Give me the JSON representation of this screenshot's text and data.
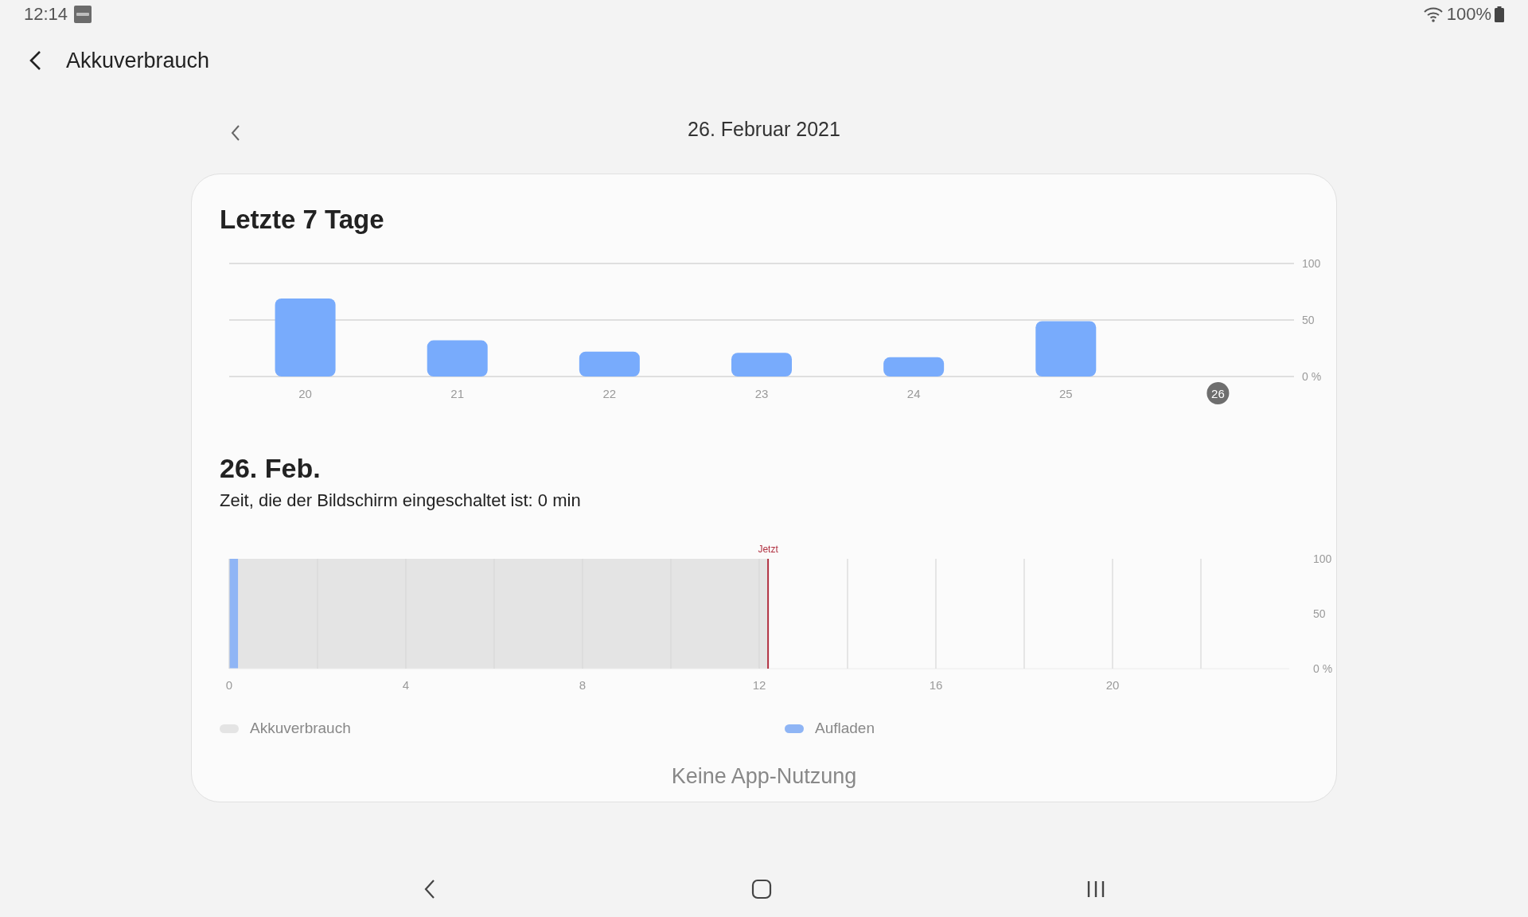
{
  "status_bar": {
    "time": "12:14",
    "battery": "100%"
  },
  "header": {
    "title": "Akkuverbrauch"
  },
  "date_nav": {
    "date": "26. Februar 2021"
  },
  "week": {
    "title": "Letzte 7 Tage",
    "days": [
      {
        "selected": false
      },
      {
        "selected": false
      },
      {
        "selected": false
      },
      {
        "selected": false
      },
      {
        "selected": false
      },
      {
        "selected": false
      },
      {
        "selected": true
      }
    ],
    "chart_data": {
      "type": "bar",
      "categories": [
        "20",
        "21",
        "22",
        "23",
        "24",
        "25",
        "26"
      ],
      "values": [
        69,
        32,
        22,
        21,
        17,
        49,
        null
      ],
      "ylim": [
        0,
        100
      ],
      "yticks": [
        {
          "value": 0,
          "label": "0 %"
        },
        {
          "value": 50,
          "label": "50"
        },
        {
          "value": 100,
          "label": "100"
        }
      ]
    }
  },
  "day": {
    "title": "26. Feb.",
    "screen_time": "Zeit, die der Bildschirm eingeschaltet ist: 0 min",
    "chart_data": {
      "type": "area",
      "x": [
        0,
        0.2,
        12.2
      ],
      "xlim": [
        0,
        24
      ],
      "ylim": [
        0,
        100
      ],
      "xticks": [
        0,
        4,
        8,
        12,
        16,
        20
      ],
      "yticks": [
        {
          "value": 0,
          "label": "0 %"
        },
        {
          "value": 50,
          "label": "50"
        },
        {
          "value": 100,
          "label": "100"
        }
      ],
      "grid": true,
      "series": [
        {
          "name": "Akkuverbrauch",
          "color": "#e4e4e4",
          "values": [
            null,
            100,
            100
          ]
        },
        {
          "name": "Aufladen",
          "color": "#8fb5f5",
          "values": [
            100,
            100,
            null
          ]
        }
      ],
      "ref_lines": [
        {
          "axis": "x",
          "value": 12.2,
          "label": "Jetzt",
          "color": "#b03040"
        }
      ]
    },
    "empty_text": "Keine App-Nutzung"
  }
}
